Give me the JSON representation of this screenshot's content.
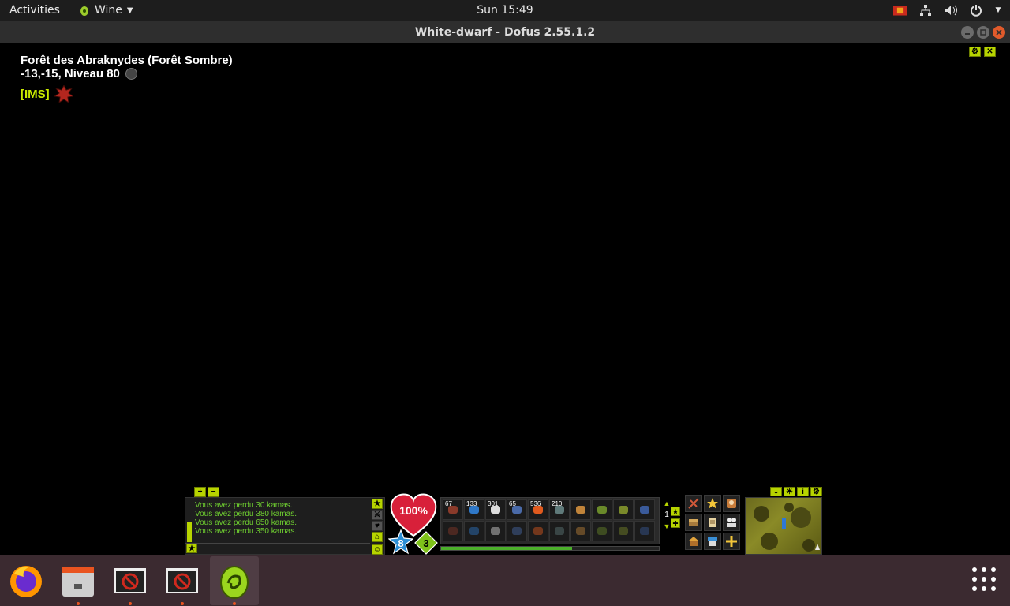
{
  "topbar": {
    "activities": "Activities",
    "app_name": "Wine",
    "clock": "Sun 15:49",
    "tray_icons": [
      "wine-tray-icon",
      "network-icon",
      "volume-icon",
      "power-icon"
    ]
  },
  "window": {
    "title": "White-dwarf - Dofus 2.55.1.2"
  },
  "game": {
    "map_name": "Forêt des Abraknydes (Forêt Sombre)",
    "map_coords": "-13,-15, Niveau 80",
    "guild_tag": "[IMS]",
    "chat_lines": [
      "Vous avez perdu 30 kamas.",
      "Vous avez perdu 380 kamas.",
      "Vous avez perdu 650 kamas.",
      "Vous avez perdu 350 kamas."
    ],
    "hp_percent": "100%",
    "action_points": "8",
    "movement_points": "3",
    "shortcut_quantities": [
      "67",
      "133",
      "301",
      "65",
      "536",
      "210",
      "",
      "",
      "",
      ""
    ],
    "shortcut_page": "1",
    "xp_progress": 0.6,
    "accent_color": "#b7d400",
    "chat_color": "#6fcf30"
  },
  "dock": {
    "items": [
      "firefox-icon",
      "files-icon",
      "wine-app-icon",
      "wine-app-icon",
      "dofus-icon"
    ]
  }
}
